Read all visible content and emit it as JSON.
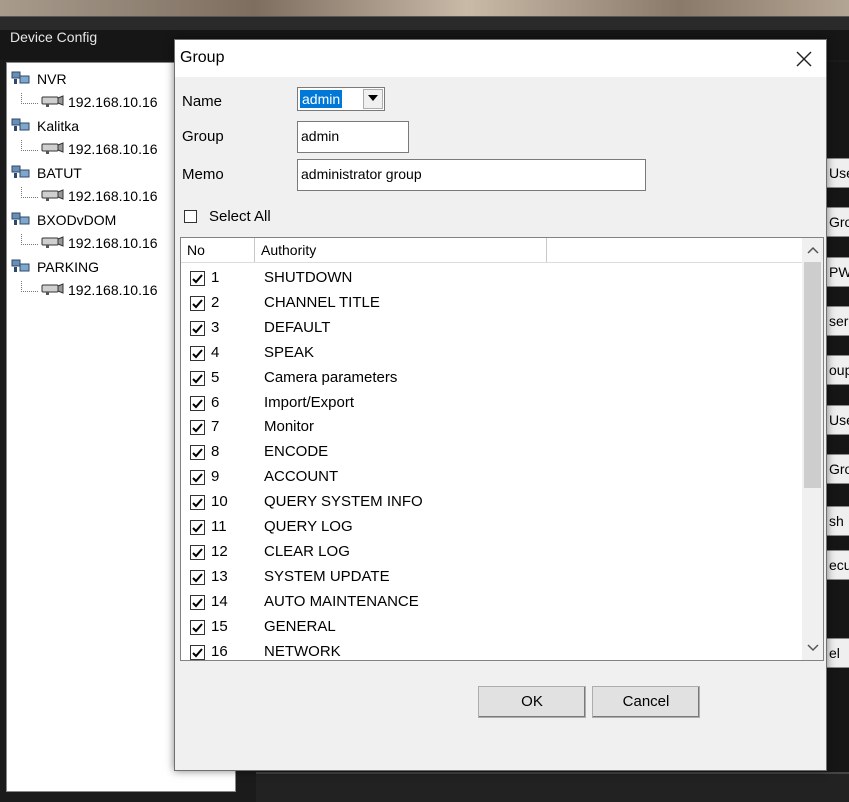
{
  "app": {
    "title": "Device Config"
  },
  "tree": [
    {
      "name": "NVR",
      "ip": "192.168.10.16"
    },
    {
      "name": "Kalitka",
      "ip": "192.168.10.16"
    },
    {
      "name": "BATUT",
      "ip": "192.168.10.16"
    },
    {
      "name": "BXODvDOM",
      "ip": "192.168.10.16"
    },
    {
      "name": "PARKING",
      "ip": "192.168.10.16"
    }
  ],
  "side_buttons": [
    "Use",
    "Grou",
    "PW",
    "ser",
    "oup",
    "Use",
    "Grou",
    "sh",
    "ecu",
    "el"
  ],
  "dialog": {
    "title": "Group",
    "close_icon": "close-icon",
    "name_label": "Name",
    "name_value": "admin",
    "group_label": "Group",
    "group_value": "admin",
    "memo_label": "Memo",
    "memo_value": "administrator group",
    "select_all_label": "Select All",
    "select_all_checked": false,
    "columns": [
      "No",
      "Authority"
    ],
    "rows": [
      {
        "no": "1",
        "authority": "SHUTDOWN",
        "checked": true
      },
      {
        "no": "2",
        "authority": "CHANNEL TITLE",
        "checked": true
      },
      {
        "no": "3",
        "authority": "DEFAULT",
        "checked": true
      },
      {
        "no": "4",
        "authority": "SPEAK",
        "checked": true
      },
      {
        "no": "5",
        "authority": "Camera parameters",
        "checked": true
      },
      {
        "no": "6",
        "authority": "Import/Export",
        "checked": true
      },
      {
        "no": "7",
        "authority": "Monitor",
        "checked": true
      },
      {
        "no": "8",
        "authority": "ENCODE",
        "checked": true
      },
      {
        "no": "9",
        "authority": "ACCOUNT",
        "checked": true
      },
      {
        "no": "10",
        "authority": "QUERY SYSTEM INFO",
        "checked": true
      },
      {
        "no": "11",
        "authority": "QUERY LOG",
        "checked": true
      },
      {
        "no": "12",
        "authority": "CLEAR LOG",
        "checked": true
      },
      {
        "no": "13",
        "authority": "SYSTEM UPDATE",
        "checked": true
      },
      {
        "no": "14",
        "authority": "AUTO MAINTENANCE",
        "checked": true
      },
      {
        "no": "15",
        "authority": "GENERAL",
        "checked": true
      },
      {
        "no": "16",
        "authority": "NETWORK",
        "checked": true
      }
    ],
    "ok_label": "OK",
    "cancel_label": "Cancel"
  },
  "colors": {
    "selection": "#0078d7",
    "dialog_bg": "#f0f0f0",
    "app_bg": "#1b1b1b"
  }
}
